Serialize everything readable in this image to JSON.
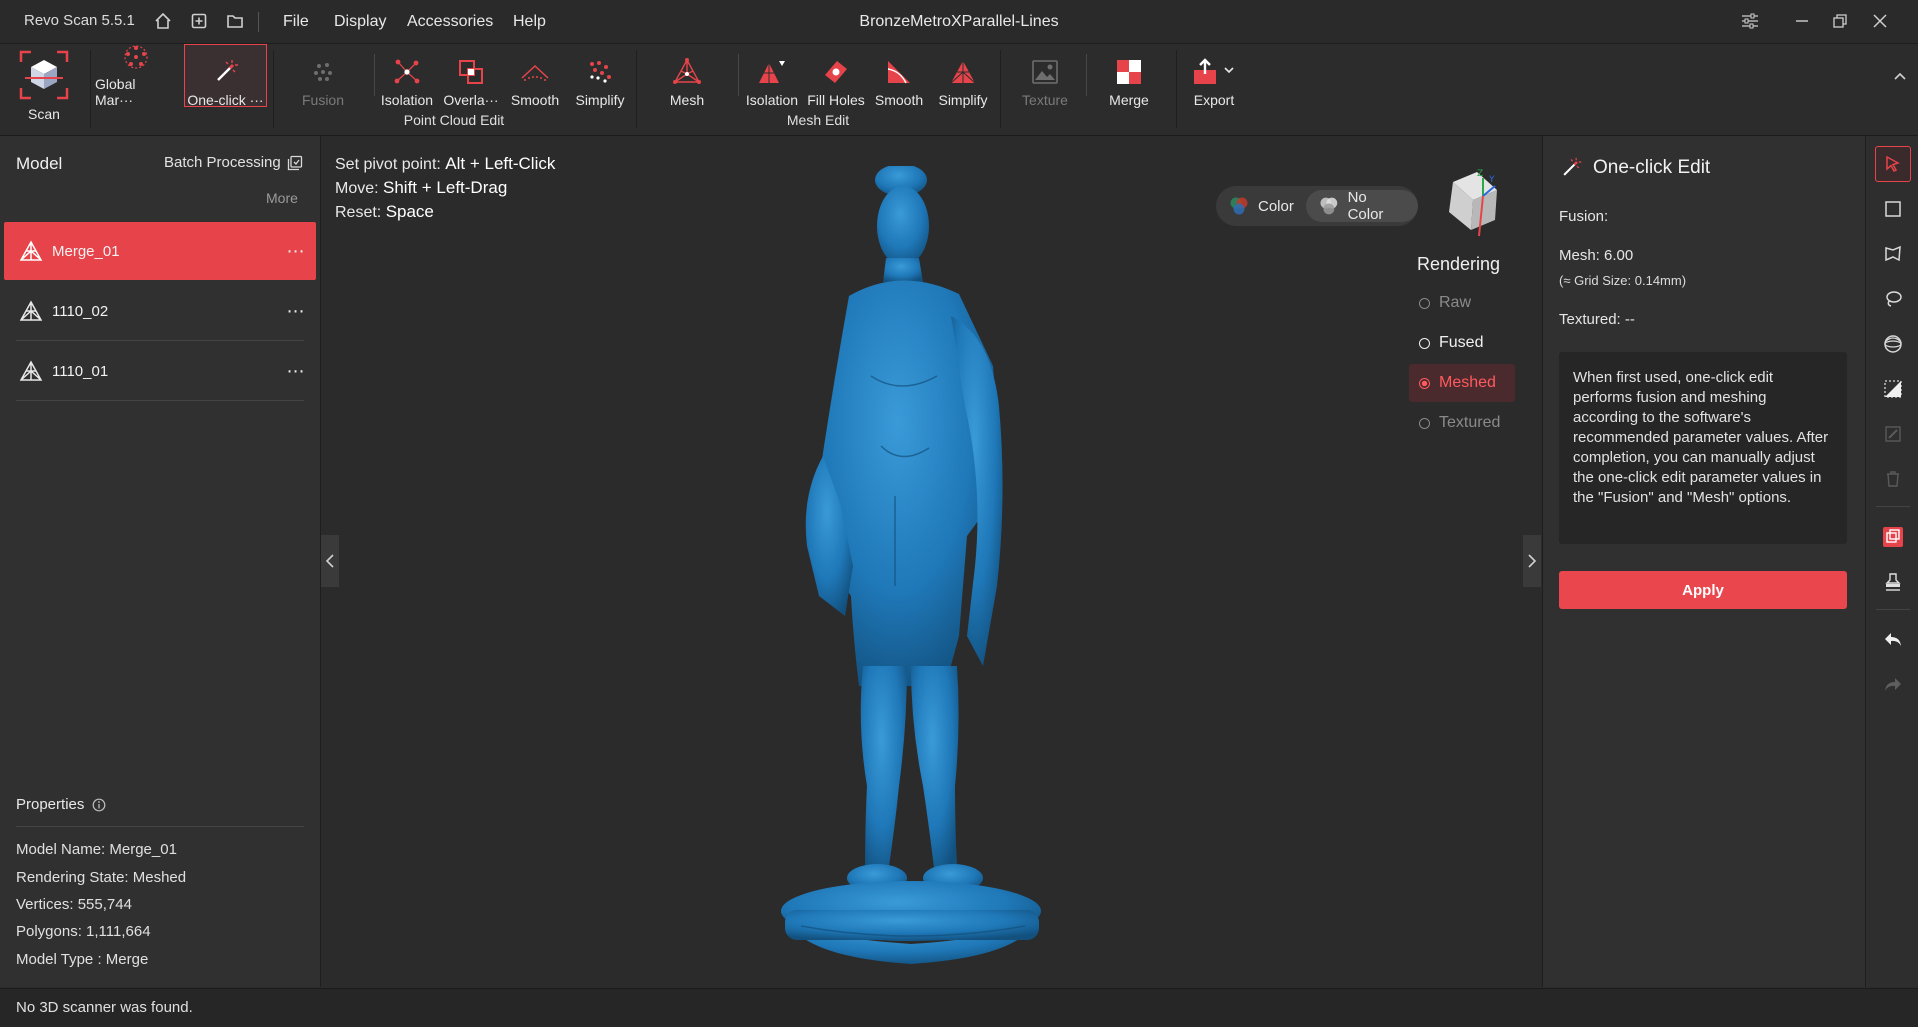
{
  "app": {
    "name": "Revo Scan 5.5.1",
    "document_title": "BronzeMetroXParallel-Lines"
  },
  "menu": [
    "File",
    "Display",
    "Accessories",
    "Help"
  ],
  "toolbar": {
    "scan": "Scan",
    "global_markers": "Global Mar···",
    "one_click": "One-click ···",
    "point_cloud": {
      "fusion": "Fusion",
      "isolation": "Isolation",
      "overlap": "Overla···",
      "smooth": "Smooth",
      "simplify": "Simplify",
      "group_label": "Point Cloud Edit"
    },
    "mesh_edit": {
      "mesh": "Mesh",
      "isolation": "Isolation",
      "fill_holes": "Fill Holes",
      "smooth": "Smooth",
      "simplify": "Simplify",
      "group_label": "Mesh Edit"
    },
    "texture": "Texture",
    "merge": "Merge",
    "export": "Export"
  },
  "left": {
    "title": "Model",
    "batch": "Batch Processing",
    "more": "More",
    "models": [
      {
        "name": "Merge_01"
      },
      {
        "name": "1110_02"
      },
      {
        "name": "1110_01"
      }
    ],
    "properties": {
      "title": "Properties",
      "model_name": "Model Name:  Merge_01",
      "rendering_state": "Rendering State:  Meshed",
      "vertices": "Vertices:  555,744",
      "polygons": "Polygons:  1,111,664",
      "model_type": "Model Type :  Merge"
    }
  },
  "viewport": {
    "hints": [
      {
        "label": "Set pivot point: ",
        "key": "Alt + Left-Click"
      },
      {
        "label": "Move: ",
        "key": "Shift + Left-Drag"
      },
      {
        "label": "Reset: ",
        "key": "Space"
      }
    ],
    "color_toggle": {
      "color": "Color",
      "no_color": "No Color",
      "selected": "No Color"
    },
    "rendering": {
      "title": "Rendering",
      "options": [
        "Raw",
        "Fused",
        "Meshed",
        "Textured"
      ],
      "selected": "Meshed"
    },
    "model_color": "#1f78b8"
  },
  "right": {
    "title": "One-click Edit",
    "fusion": "Fusion:",
    "mesh": "Mesh:  6.00",
    "grid": "(≈ Grid Size: 0.14mm)",
    "textured": "Textured: --",
    "info": "When first used, one-click edit performs fusion and meshing according to the software's recommended parameter values. After completion, you can manually adjust the one-click edit parameter values in the \"Fusion\" and \"Mesh\" options.",
    "apply": "Apply"
  },
  "accent_color": "#e6444a",
  "status": "No 3D scanner was found."
}
